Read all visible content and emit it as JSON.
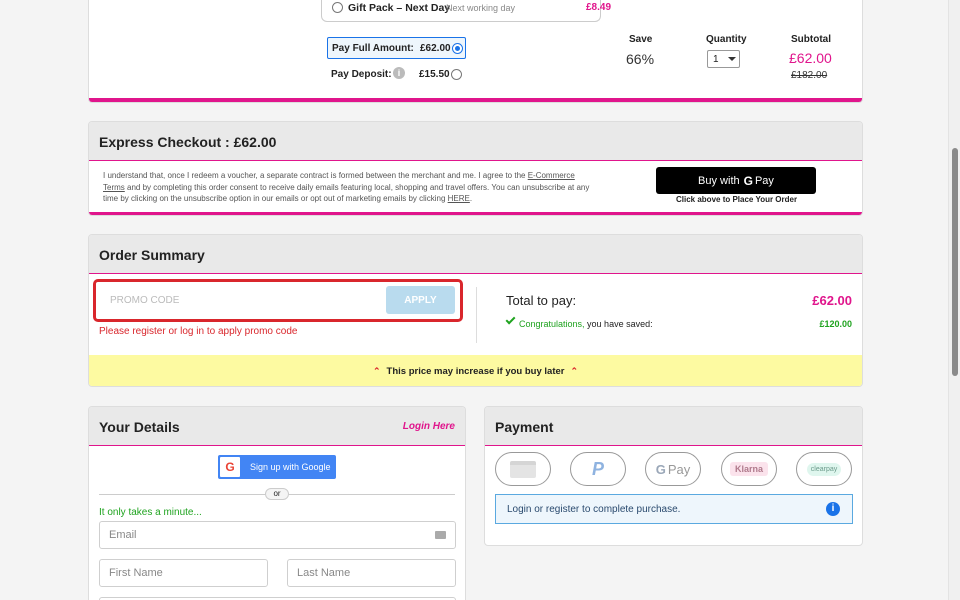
{
  "delivery": {
    "option_label": "Gift Pack – Next Day",
    "option_sub": "Next working day",
    "option_price": "£8.49"
  },
  "pricing": {
    "full_label": "Pay Full Amount:",
    "full_amount": "£62.00",
    "deposit_label": "Pay Deposit:",
    "deposit_amount": "£15.50",
    "save_header": "Save",
    "save_value": "66%",
    "qty_header": "Quantity",
    "qty_value": "1",
    "subtotal_header": "Subtotal",
    "subtotal_value": "£62.00",
    "subtotal_was": "£182.00"
  },
  "express": {
    "title": "Express Checkout : £62.00",
    "terms_before": "I understand that, once I redeem a voucher, a separate contract is formed between the merchant and me. I agree to the ",
    "terms_link": "E-Commerce Terms",
    "terms_middle": " and by completing this order consent to receive daily emails featuring local, shopping and travel offers. You can unsubscribe at any time by clicking on the unsubscribe option in our emails or opt out of marketing emails by clicking ",
    "here_link": "HERE",
    "terms_end": ".",
    "gpay_prefix": "Buy with",
    "gpay_word": "Pay",
    "gpay_caption": "Click above to Place Your Order"
  },
  "summary": {
    "title": "Order Summary",
    "promo_placeholder": "PROMO CODE",
    "apply_label": "APPLY",
    "promo_error": "Please register or log in to apply promo code",
    "total_label": "Total to pay:",
    "total_value": "£62.00",
    "congrats": "Congratulations,",
    "saved_text": " you have saved:",
    "saved_value": "£120.00",
    "warning": "This price may increase if you buy later"
  },
  "details": {
    "title": "Your Details",
    "login_link": "Login Here",
    "google_signup": "Sign up with Google",
    "or": "or",
    "minute": "It only takes a minute...",
    "email_placeholder": "Email",
    "first_placeholder": "First Name",
    "last_placeholder": "Last Name"
  },
  "payment": {
    "title": "Payment",
    "gpay_word": "Pay",
    "klarna": "Klarna",
    "clearpay": "clearpay",
    "login_note": "Login or register to complete purchase."
  },
  "colors": {
    "accent": "#e0158c",
    "success": "#1fa31f",
    "error": "#d9262c",
    "info_bg": "#eef6fc",
    "warning_bg": "#fdfaa1"
  }
}
